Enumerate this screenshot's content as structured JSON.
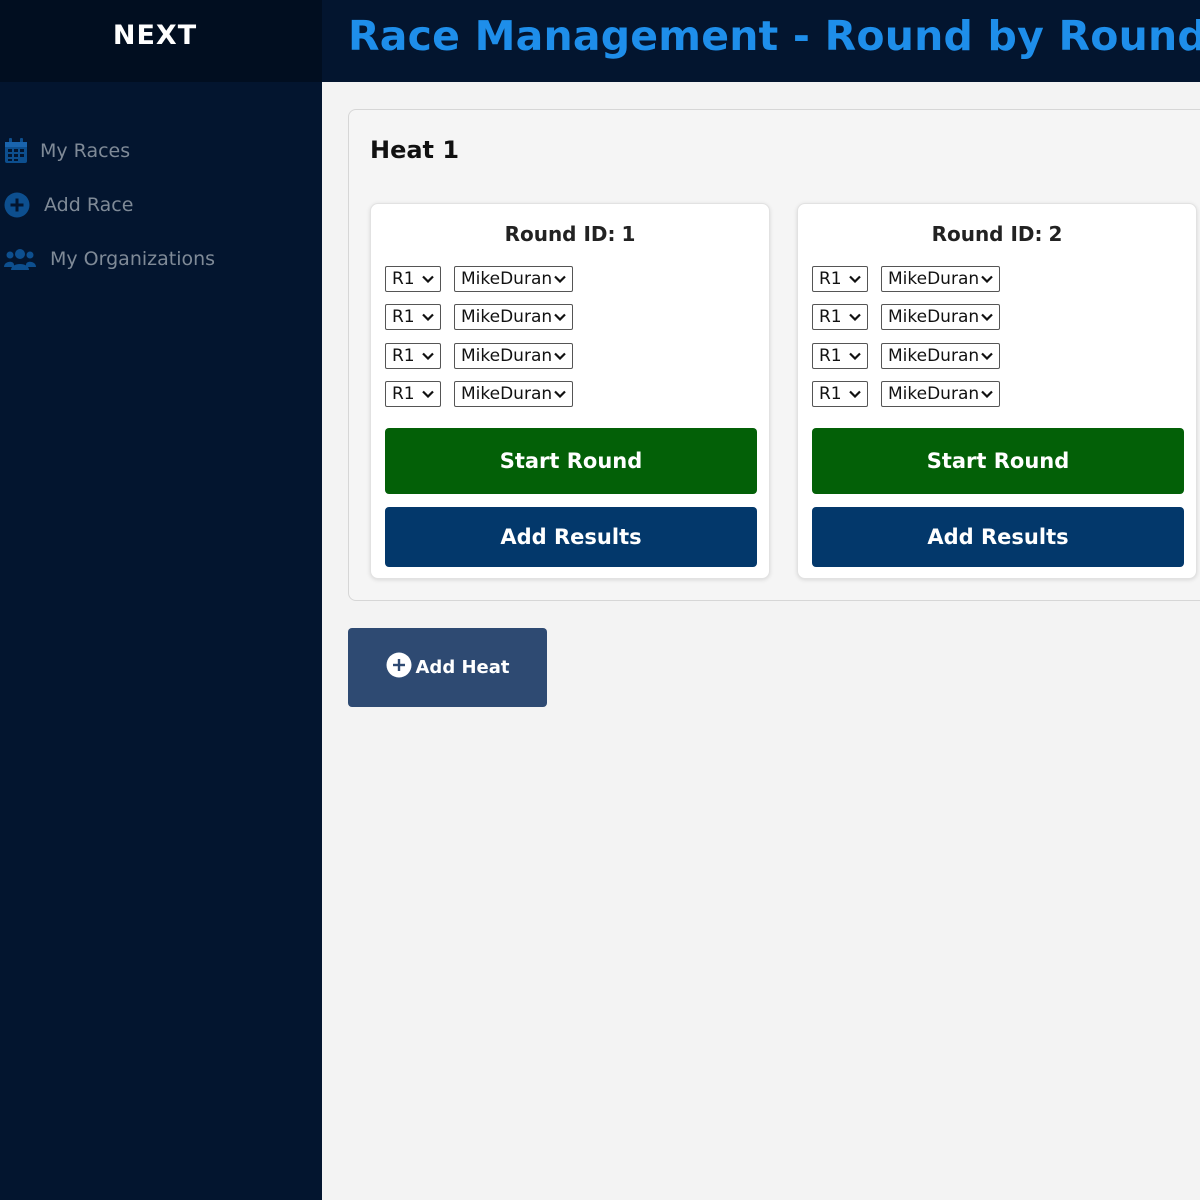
{
  "app": {
    "logo_text": "NEXT",
    "page_title": "Race Management - Round by Round"
  },
  "sidebar": {
    "items": [
      {
        "label": "My Races",
        "icon": "calendar-icon"
      },
      {
        "label": "Add Race",
        "icon": "plus-circle-icon"
      },
      {
        "label": "My Organizations",
        "icon": "users-icon"
      }
    ]
  },
  "heat": {
    "title": "Heat 1",
    "rounds": [
      {
        "label": "Round ID:",
        "id": "1",
        "rows": [
          {
            "lane": "R1",
            "racer": "MikeDuran"
          },
          {
            "lane": "R1",
            "racer": "MikeDuran"
          },
          {
            "lane": "R1",
            "racer": "MikeDuran"
          },
          {
            "lane": "R1",
            "racer": "MikeDuran"
          }
        ],
        "start_label": "Start Round",
        "results_label": "Add Results"
      },
      {
        "label": "Round ID:",
        "id": "2",
        "rows": [
          {
            "lane": "R1",
            "racer": "MikeDuran"
          },
          {
            "lane": "R1",
            "racer": "MikeDuran"
          },
          {
            "lane": "R1",
            "racer": "MikeDuran"
          },
          {
            "lane": "R1",
            "racer": "MikeDuran"
          }
        ],
        "start_label": "Start Round",
        "results_label": "Add Results"
      }
    ]
  },
  "add_heat": {
    "label": "Add Heat",
    "icon": "plus-circle-icon"
  },
  "colors": {
    "sidebar_bg": "#03152f",
    "title_blue": "#1e8eea",
    "start_green": "#036007",
    "results_blue": "#03386b",
    "add_heat_bg": "#2e4a72"
  }
}
